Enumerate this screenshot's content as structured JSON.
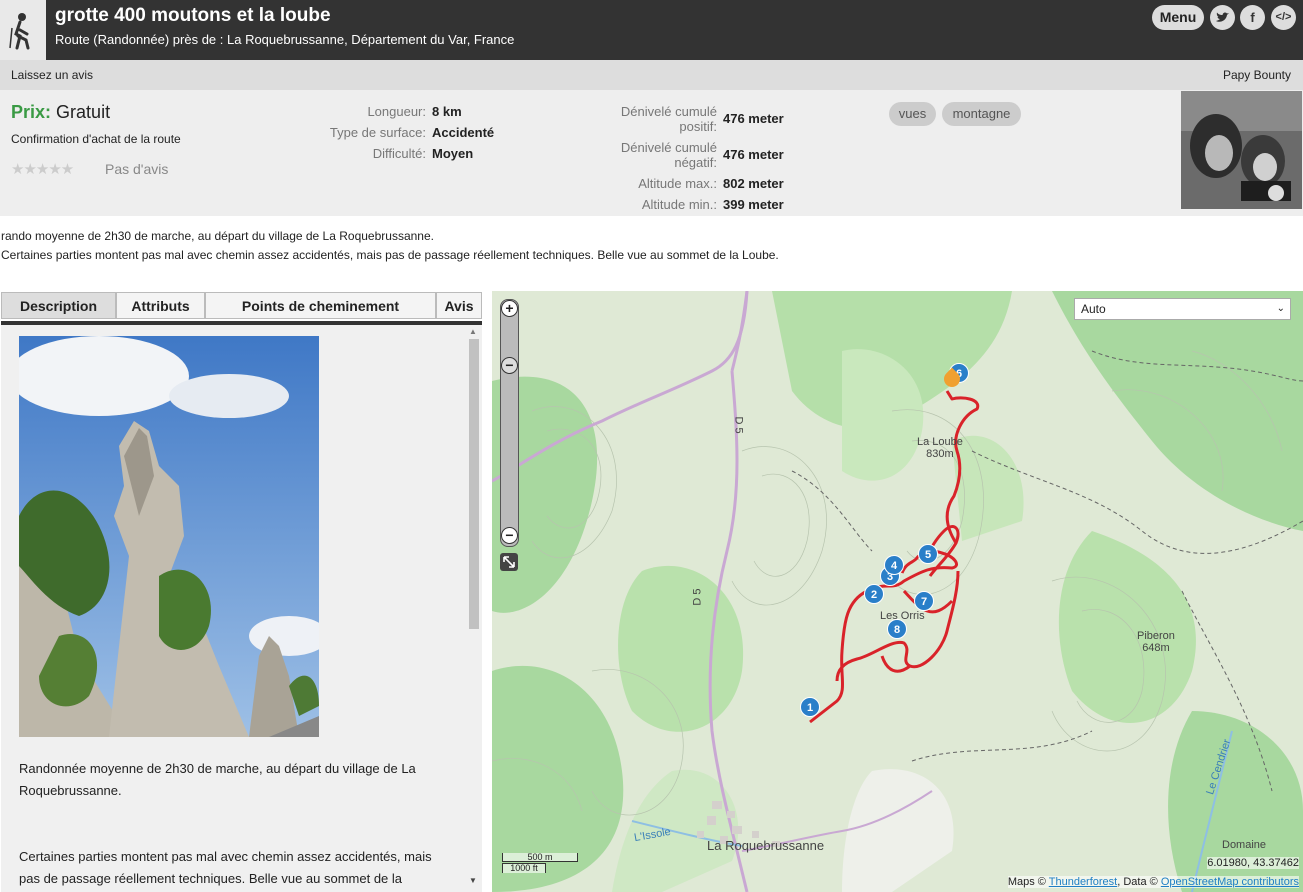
{
  "header": {
    "title": "grotte 400 moutons et la loube",
    "subtitle": "Route (Randonnée) près de : La Roquebrussanne, Département du Var, France",
    "menu_label": "Menu",
    "social": [
      "twitter-icon",
      "facebook-icon",
      "embed-icon"
    ]
  },
  "subbar": {
    "review_link": "Laissez un avis",
    "author": "Papy Bounty"
  },
  "info": {
    "price_label": "Prix:",
    "price_value": "Gratuit",
    "confirm": "Confirmation d'achat de la route",
    "stars": "★★★★★",
    "rating_count": 0,
    "no_reviews": "Pas d'avis",
    "stats_left": [
      {
        "k": "Longueur:",
        "v": "8 km"
      },
      {
        "k": "Type de surface:",
        "v": "Accidenté"
      },
      {
        "k": "Difficulté:",
        "v": "Moyen"
      }
    ],
    "stats_right": [
      {
        "k1": "Dénivelé cumulé",
        "k2": "positif:",
        "v": "476 meter"
      },
      {
        "k1": "Dénivelé cumulé",
        "k2": "négatif:",
        "v": "476 meter"
      },
      {
        "k1": "Altitude max.:",
        "v": "802 meter"
      },
      {
        "k1": "Altitude min.:",
        "v": "399 meter"
      }
    ],
    "tags": [
      "vues",
      "montagne"
    ]
  },
  "summary": [
    "rando moyenne de 2h30 de marche, au départ du village de La Roquebrussanne.",
    "Certaines parties montent pas mal avec chemin assez accidentés, mais pas de passage réellement techniques. Belle vue au sommet de la Loube."
  ],
  "tabs": [
    "Description",
    "Attributs",
    "Points de cheminement",
    "Avis"
  ],
  "description": {
    "para1": "Randonnée moyenne de 2h30 de marche, au départ du village de La Roquebrussanne.",
    "para2": "Certaines parties montent pas mal avec chemin assez accidentés, mais pas de passage réellement techniques. Belle vue au sommet de la"
  },
  "map": {
    "layer_select": "Auto",
    "waypoints": [
      "1",
      "2",
      "3",
      "4",
      "5",
      "6",
      "7",
      "8"
    ],
    "labels": {
      "loube": "La Loube",
      "loube_alt": "830m",
      "orris": "Les Orris",
      "piberon": "Piberon",
      "piberon_alt": "648m",
      "village": "La Roquebrussanne",
      "issole": "L'Issole",
      "cendrier": "Le Cendrier",
      "domaine": "Domaine",
      "d5": "D 5"
    },
    "scale_m": "500 m",
    "scale_ft": "1000 ft",
    "coords": "6.01980, 43.37462",
    "attrib_prefix": "Maps ©",
    "attrib_tf": "Thunderforest",
    "attrib_mid": ", Data ©",
    "attrib_osm": "OpenStreetMap contributors"
  },
  "colors": {
    "accent_green": "#3a9a44",
    "route_red": "#d9232a",
    "waypoint_blue": "#2a7fc9",
    "header_bg": "#333333"
  }
}
